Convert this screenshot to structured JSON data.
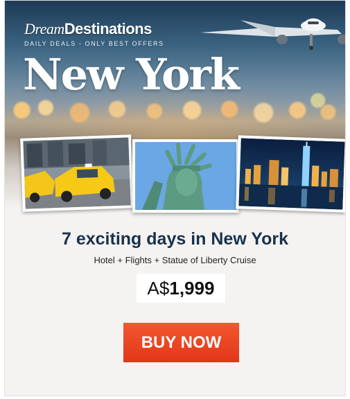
{
  "brand": {
    "name_part1": "Dream",
    "name_part2": "Destinations",
    "tagline": "DAILY DEALS - ONLY BEST OFFERS"
  },
  "hero": {
    "destination": "New York"
  },
  "photos": [
    {
      "subject": "yellow taxis"
    },
    {
      "subject": "statue of liberty"
    },
    {
      "subject": "city skyline at night"
    }
  ],
  "offer": {
    "headline": "7 exciting days in New York",
    "includes": "Hotel + Flights + Statue of Liberty Cruise",
    "currency": "A$",
    "amount": "1,999"
  },
  "cta": {
    "label": "BUY NOW"
  },
  "colors": {
    "headline": "#17324d",
    "button": "#e2361a",
    "background": "#f5f3f1"
  }
}
